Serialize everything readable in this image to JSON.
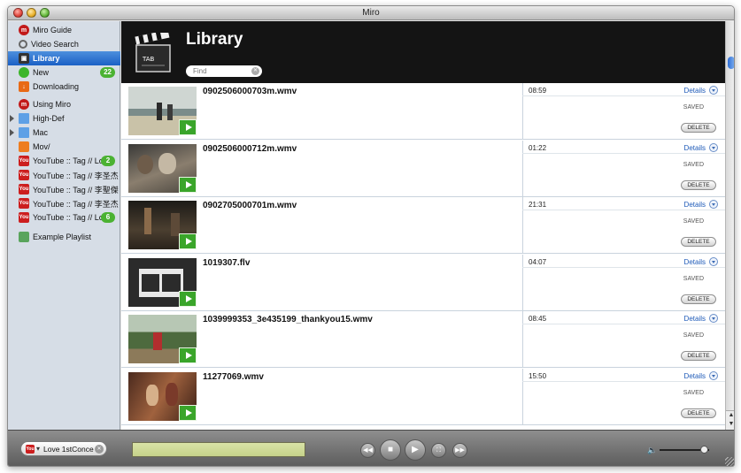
{
  "window": {
    "title": "Miro"
  },
  "sidebar": {
    "items": [
      {
        "label": "Miro Guide",
        "icon": "miro-icon",
        "kind": "miro"
      },
      {
        "label": "Video Search",
        "icon": "search-icon",
        "kind": "search"
      },
      {
        "label": "Library",
        "icon": "library-icon",
        "kind": "lib",
        "selected": true
      },
      {
        "label": "New",
        "icon": "new-icon",
        "kind": "green",
        "badge": "22"
      },
      {
        "label": "Downloading",
        "icon": "download-icon",
        "kind": "down"
      },
      {
        "label": "Using Miro",
        "icon": "miro-icon",
        "kind": "miro"
      },
      {
        "label": "High-Def",
        "icon": "folder-icon",
        "kind": "folder",
        "expandable": true
      },
      {
        "label": "Mac",
        "icon": "folder-icon",
        "kind": "folder",
        "expandable": true
      },
      {
        "label": "Mov/",
        "icon": "rss-icon",
        "kind": "rss"
      },
      {
        "label": "YouTube :: Tag // Lo",
        "icon": "youtube-icon",
        "kind": "yt",
        "badge": "2"
      },
      {
        "label": "YouTube :: Tag // 李圣杰",
        "icon": "youtube-icon",
        "kind": "yt"
      },
      {
        "label": "YouTube :: Tag // 李聖傑",
        "icon": "youtube-icon",
        "kind": "yt"
      },
      {
        "label": "YouTube :: Tag // 李圣杰",
        "icon": "youtube-icon",
        "kind": "yt"
      },
      {
        "label": "YouTube :: Tag // Lo",
        "icon": "youtube-icon",
        "kind": "yt",
        "badge": "6"
      },
      {
        "label": "Example Playlist",
        "icon": "playlist-icon",
        "kind": "playlist"
      }
    ]
  },
  "header": {
    "title": "Library",
    "search_placeholder": "Find",
    "clapper_text": "TAB"
  },
  "videos": [
    {
      "filename": "0902506000703m.wmv",
      "duration": "08:59",
      "details_label": "Details",
      "status": "SAVED",
      "delete_label": "DELETE",
      "scene": "beach"
    },
    {
      "filename": "0902506000712m.wmv",
      "duration": "01:22",
      "details_label": "Details",
      "status": "SAVED",
      "delete_label": "DELETE",
      "scene": "street"
    },
    {
      "filename": "0902705000701m.wmv",
      "duration": "21:31",
      "details_label": "Details",
      "status": "SAVED",
      "delete_label": "DELETE",
      "scene": "dark"
    },
    {
      "filename": "1019307.flv",
      "duration": "04:07",
      "details_label": "Details",
      "status": "SAVED",
      "delete_label": "DELETE",
      "scene": "filmstrip"
    },
    {
      "filename": "1039999353_3e435199_thankyou15.wmv",
      "duration": "08:45",
      "details_label": "Details",
      "status": "SAVED",
      "delete_label": "DELETE",
      "scene": "garden"
    },
    {
      "filename": "11277069.wmv",
      "duration": "15:50",
      "details_label": "Details",
      "status": "SAVED",
      "delete_label": "DELETE",
      "scene": "indoor"
    }
  ],
  "player": {
    "channel_label": "Love 1stConce",
    "channel_icon": "youtube-icon",
    "controls": [
      "rewind-icon",
      "stop-icon",
      "play-icon",
      "fullscreen-icon",
      "fast-forward-icon"
    ],
    "volume": 0.9
  },
  "colors": {
    "sidebar_bg": "#d6dde6",
    "selected": "#1b60c5",
    "badge": "#4bb232",
    "header_bg": "#141414",
    "link": "#1e5ab8"
  }
}
